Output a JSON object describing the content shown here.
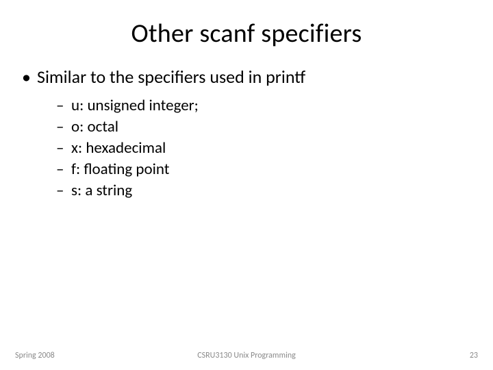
{
  "title": "Other scanf specifiers",
  "bullet": "Similar to the specifiers used in printf",
  "items": [
    "u: unsigned integer;",
    "o: octal",
    "x: hexadecimal",
    "f: floating point",
    "s: a string"
  ],
  "footer": {
    "left": "Spring 2008",
    "center": "CSRU3130 Unix Programming",
    "right": "23"
  }
}
